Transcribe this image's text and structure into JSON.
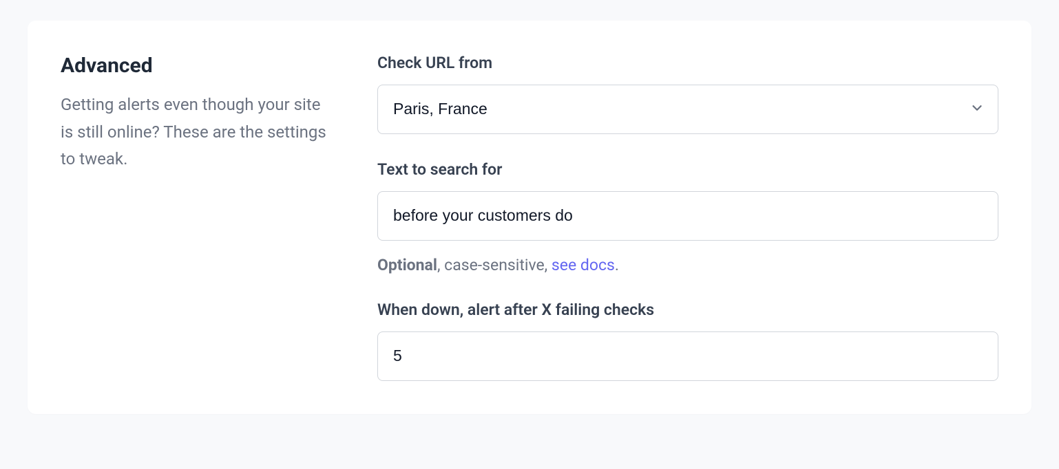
{
  "section": {
    "title": "Advanced",
    "description": "Getting alerts even though your site is still online? These are the settings to tweak."
  },
  "form": {
    "check_url": {
      "label": "Check URL from",
      "value": "Paris, France"
    },
    "search_text": {
      "label": "Text to search for",
      "value": "before your customers do",
      "help_bold": "Optional",
      "help_mid": ", case-sensitive, ",
      "help_link": "see docs",
      "help_period": "."
    },
    "alert_after": {
      "label": "When down, alert after X failing checks",
      "value": "5"
    }
  }
}
